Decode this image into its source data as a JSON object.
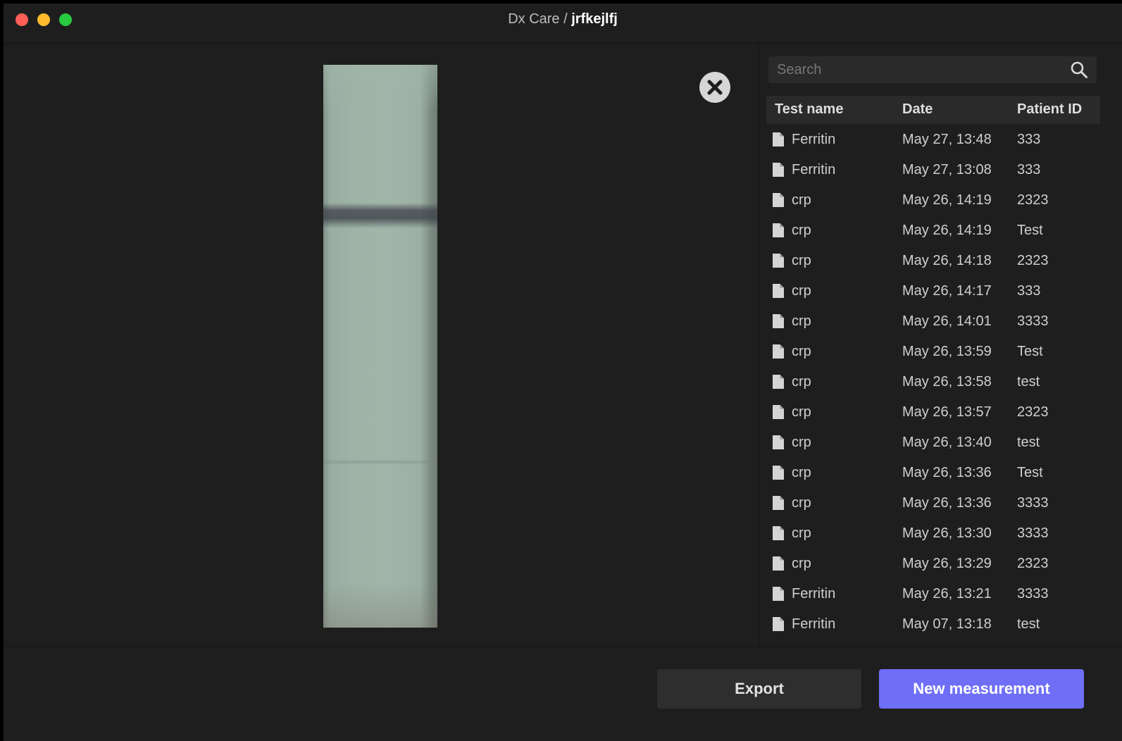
{
  "window": {
    "app_name": "Dx Care",
    "separator": " / ",
    "user": "jrfkejlfj"
  },
  "search": {
    "placeholder": "Search",
    "value": ""
  },
  "table": {
    "headers": {
      "test_name": "Test name",
      "date": "Date",
      "patient_id": "Patient ID"
    },
    "rows": [
      {
        "test": "Ferritin",
        "date": "May 27, 13:48",
        "pid": "333"
      },
      {
        "test": "Ferritin",
        "date": "May 27, 13:08",
        "pid": "333"
      },
      {
        "test": "crp",
        "date": "May 26, 14:19",
        "pid": "2323"
      },
      {
        "test": "crp",
        "date": "May 26, 14:19",
        "pid": "Test"
      },
      {
        "test": "crp",
        "date": "May 26, 14:18",
        "pid": "2323"
      },
      {
        "test": "crp",
        "date": "May 26, 14:17",
        "pid": "333"
      },
      {
        "test": "crp",
        "date": "May 26, 14:01",
        "pid": "3333"
      },
      {
        "test": "crp",
        "date": "May 26, 13:59",
        "pid": "Test"
      },
      {
        "test": "crp",
        "date": "May 26, 13:58",
        "pid": "test"
      },
      {
        "test": "crp",
        "date": "May 26, 13:57",
        "pid": "2323"
      },
      {
        "test": "crp",
        "date": "May 26, 13:40",
        "pid": "test"
      },
      {
        "test": "crp",
        "date": "May 26, 13:36",
        "pid": "Test"
      },
      {
        "test": "crp",
        "date": "May 26, 13:36",
        "pid": "3333"
      },
      {
        "test": "crp",
        "date": "May 26, 13:30",
        "pid": "3333"
      },
      {
        "test": "crp",
        "date": "May 26, 13:29",
        "pid": "2323"
      },
      {
        "test": "Ferritin",
        "date": "May 26, 13:21",
        "pid": "3333"
      },
      {
        "test": "Ferritin",
        "date": "May 07, 13:18",
        "pid": "test"
      }
    ]
  },
  "footer": {
    "export_label": "Export",
    "new_measurement_label": "New measurement"
  },
  "icons": {
    "close": "close-circle-icon",
    "search": "search-icon",
    "row": "document-icon"
  },
  "colors": {
    "accent": "#6e6ef7",
    "window_bg": "#1e1e1e",
    "traffic_red": "#fe5f57",
    "traffic_yellow": "#febc2e",
    "traffic_green": "#28c840"
  }
}
